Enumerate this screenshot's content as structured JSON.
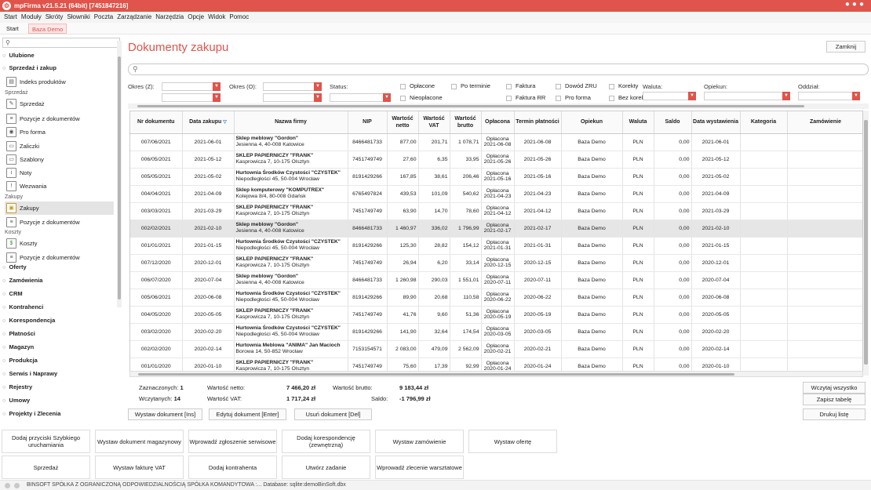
{
  "window": {
    "title": "mpFirma v21.5.21 (64bit) [7451847216]"
  },
  "menu": [
    "Start",
    "Moduły",
    "Skróty",
    "Słowniki",
    "Poczta",
    "Zarządzanie",
    "Narzędzia",
    "Opcje",
    "Widok",
    "Pomoc"
  ],
  "tabs": [
    {
      "label": "Start"
    },
    {
      "label": "Baza Demo"
    }
  ],
  "sidebar": {
    "search_placeholder": "",
    "sections_top": [
      {
        "label": "Ulubione"
      },
      {
        "label": "Sprzedaż i zakup"
      }
    ],
    "items_a": [
      {
        "label": "Indeks produktów",
        "icon": "box-icon"
      }
    ],
    "sub_sprzedaz": "Sprzedaż",
    "items_b": [
      {
        "label": "Sprzedaż"
      },
      {
        "label": "Pozycje z dokumentów"
      },
      {
        "label": "Pro forma"
      },
      {
        "label": "Zaliczki"
      },
      {
        "label": "Szablony"
      },
      {
        "label": "Noty"
      },
      {
        "label": "Wezwania"
      }
    ],
    "sub_zakupy": "Zakupy",
    "items_c": [
      {
        "label": "Zakupy"
      },
      {
        "label": "Pozycje z dokumentów"
      }
    ],
    "sub_koszty": "Koszty",
    "items_d": [
      {
        "label": "Koszty"
      },
      {
        "label": "Pozycje z dokumentów"
      }
    ],
    "sections_bottom": [
      {
        "label": "Oferty"
      },
      {
        "label": "Zamówienia"
      },
      {
        "label": "CRM"
      },
      {
        "label": "Kontrahenci"
      },
      {
        "label": "Korespondencja"
      },
      {
        "label": "Płatności"
      },
      {
        "label": "Magazyn"
      },
      {
        "label": "Produkcja"
      },
      {
        "label": "Serwis i Naprawy"
      },
      {
        "label": "Rejestry"
      },
      {
        "label": "Umowy"
      },
      {
        "label": "Projekty i Zlecenia"
      }
    ]
  },
  "main": {
    "title": "Dokumenty zakupu",
    "close_label": "Zamknij",
    "search_placeholder": "",
    "filters": {
      "okres_z": "Okres (Z):",
      "okres_o": "Okres (O):",
      "status": "Status:",
      "waluta": "Waluta:",
      "opiekun": "Opiekun:",
      "oddzial": "Oddział:"
    },
    "checks": [
      "Opłacone",
      "Po terminie",
      "Faktura",
      "Dowód ZRU",
      "Korekty",
      "Nieopłacone",
      "Faktura RR",
      "Pro forma",
      "Bez korekt"
    ],
    "columns": [
      "Nr dokumentu",
      "Data zakupu",
      "Nazwa firmy",
      "NIP",
      "Wartość netto",
      "Wartość VAT",
      "Wartość brutto",
      "Opłacona",
      "Termin płatności",
      "Opiekun",
      "Waluta",
      "Saldo",
      "Data wystawienia",
      "Kategoria",
      "Zamówienie"
    ],
    "rows": [
      {
        "nr": "007/06/2021",
        "data": "2021-06-01",
        "firma": "Sklep meblowy \"Gordon\"",
        "adres": "Jesienna 4, 40-008 Katowice",
        "nip": "8466481733",
        "netto": "877,00",
        "vat": "201,71",
        "brutto": "1 078,71",
        "op": "Opłacona",
        "opdata": "2021-06-08",
        "termin": "2021-06-08",
        "opiekun": "Baza Demo",
        "waluta": "PLN",
        "saldo": "0,00",
        "wyst": "2021-06-01",
        "kat": "",
        "zam": ""
      },
      {
        "nr": "006/05/2021",
        "data": "2021-05-12",
        "firma": "SKLEP PAPIERNICZY \"FRANK\"",
        "adres": "Kasprowicza 7, 10-175 Olsztyn",
        "nip": "7451749749",
        "netto": "27,60",
        "vat": "6,35",
        "brutto": "33,95",
        "op": "Opłacona",
        "opdata": "2021-05-26",
        "termin": "2021-05-26",
        "opiekun": "Baza Demo",
        "waluta": "PLN",
        "saldo": "0,00",
        "wyst": "2021-05-12",
        "kat": "",
        "zam": ""
      },
      {
        "nr": "005/05/2021",
        "data": "2021-05-02",
        "firma": "Hurtownia Środków Czystości \"CZYSTEK\"",
        "adres": "Niepodległości 45, 50-004 Wrocław",
        "nip": "8191429266",
        "netto": "167,85",
        "vat": "38,61",
        "brutto": "206,46",
        "op": "Opłacona",
        "opdata": "2021-05-16",
        "termin": "2021-05-16",
        "opiekun": "Baza Demo",
        "waluta": "PLN",
        "saldo": "0,00",
        "wyst": "2021-05-02",
        "kat": "",
        "zam": ""
      },
      {
        "nr": "004/04/2021",
        "data": "2021-04-09",
        "firma": "Sklep komputerowy \"KOMPUTREX\"",
        "adres": "Kolejowa 8/4, 80-008 Gdańsk",
        "nip": "6765497824",
        "netto": "439,53",
        "vat": "101,09",
        "brutto": "540,62",
        "op": "Opłacona",
        "opdata": "2021-04-23",
        "termin": "2021-04-23",
        "opiekun": "Baza Demo",
        "waluta": "PLN",
        "saldo": "0,00",
        "wyst": "2021-04-09",
        "kat": "",
        "zam": ""
      },
      {
        "nr": "003/03/2021",
        "data": "2021-03-29",
        "firma": "SKLEP PAPIERNICZY \"FRANK\"",
        "adres": "Kasprowicza 7, 10-175 Olsztyn",
        "nip": "7451749749",
        "netto": "63,90",
        "vat": "14,70",
        "brutto": "78,60",
        "op": "Opłacona",
        "opdata": "2021-04-12",
        "termin": "2021-04-12",
        "opiekun": "Baza Demo",
        "waluta": "PLN",
        "saldo": "0,00",
        "wyst": "2021-03-29",
        "kat": "",
        "zam": ""
      },
      {
        "nr": "002/02/2021",
        "data": "2021-02-10",
        "firma": "Sklep meblowy \"Gordon\"",
        "adres": "Jesienna 4, 40-008 Katowice",
        "nip": "8466481733",
        "netto": "1 460,97",
        "vat": "336,02",
        "brutto": "1 796,99",
        "op": "Opłacona",
        "opdata": "2021-02-17",
        "termin": "2021-02-17",
        "opiekun": "Baza Demo",
        "waluta": "PLN",
        "saldo": "0,00",
        "wyst": "2021-02-10",
        "kat": "",
        "zam": ""
      },
      {
        "nr": "001/01/2021",
        "data": "2021-01-15",
        "firma": "Hurtownia Środków Czystości \"CZYSTEK\"",
        "adres": "Niepodległości 45, 50-004 Wrocław",
        "nip": "8191429266",
        "netto": "125,30",
        "vat": "28,82",
        "brutto": "154,12",
        "op": "Opłacona",
        "opdata": "2021-01-31",
        "termin": "2021-01-31",
        "opiekun": "Baza Demo",
        "waluta": "PLN",
        "saldo": "0,00",
        "wyst": "2021-01-15",
        "kat": "",
        "zam": ""
      },
      {
        "nr": "007/12/2020",
        "data": "2020-12-01",
        "firma": "SKLEP PAPIERNICZY \"FRANK\"",
        "adres": "Kasprowicza 7, 10-175 Olsztyn",
        "nip": "7451749749",
        "netto": "26,94",
        "vat": "6,20",
        "brutto": "33,14",
        "op": "Opłacona",
        "opdata": "2020-12-15",
        "termin": "2020-12-15",
        "opiekun": "Baza Demo",
        "waluta": "PLN",
        "saldo": "0,00",
        "wyst": "2020-12-01",
        "kat": "",
        "zam": ""
      },
      {
        "nr": "006/07/2020",
        "data": "2020-07-04",
        "firma": "Sklep meblowy \"Gordon\"",
        "adres": "Jesienna 4, 40-008 Katowice",
        "nip": "8466481733",
        "netto": "1 260,98",
        "vat": "290,03",
        "brutto": "1 551,01",
        "op": "Opłacona",
        "opdata": "2020-07-11",
        "termin": "2020-07-11",
        "opiekun": "Baza Demo",
        "waluta": "PLN",
        "saldo": "0,00",
        "wyst": "2020-07-04",
        "kat": "",
        "zam": ""
      },
      {
        "nr": "005/06/2021",
        "data": "2020-06-08",
        "firma": "Hurtownia Środków Czystości \"CZYSTEK\"",
        "adres": "Niepodległości 45, 50-004 Wrocław",
        "nip": "8191429266",
        "netto": "89,90",
        "vat": "20,68",
        "brutto": "110,58",
        "op": "Opłacona",
        "opdata": "2020-06-22",
        "termin": "2020-06-22",
        "opiekun": "Baza Demo",
        "waluta": "PLN",
        "saldo": "0,00",
        "wyst": "2020-06-08",
        "kat": "",
        "zam": ""
      },
      {
        "nr": "004/05/2020",
        "data": "2020-05-05",
        "firma": "SKLEP PAPIERNICZY \"FRANK\"",
        "adres": "Kasprowicza 7, 10-175 Olsztyn",
        "nip": "7451749749",
        "netto": "41,76",
        "vat": "9,60",
        "brutto": "51,36",
        "op": "Opłacona",
        "opdata": "2020-05-19",
        "termin": "2020-05-19",
        "opiekun": "Baza Demo",
        "waluta": "PLN",
        "saldo": "0,00",
        "wyst": "2020-05-05",
        "kat": "",
        "zam": ""
      },
      {
        "nr": "003/02/2020",
        "data": "2020-02-20",
        "firma": "Hurtownia Środków Czystości \"CZYSTEK\"",
        "adres": "Niepodległości 45, 50-004 Wrocław",
        "nip": "8191429266",
        "netto": "141,90",
        "vat": "32,64",
        "brutto": "174,54",
        "op": "Opłacona",
        "opdata": "2020-03-05",
        "termin": "2020-03-05",
        "opiekun": "Baza Demo",
        "waluta": "PLN",
        "saldo": "0,00",
        "wyst": "2020-02-20",
        "kat": "",
        "zam": ""
      },
      {
        "nr": "002/02/2020",
        "data": "2020-02-14",
        "firma": "Hurtownia Meblowa \"ANIMA\" Jan Macioch",
        "adres": "Borowa 14, 50-852 Wrocław",
        "nip": "7153154571",
        "netto": "2 083,00",
        "vat": "479,09",
        "brutto": "2 562,09",
        "op": "Opłacona",
        "opdata": "2020-02-21",
        "termin": "2020-02-21",
        "opiekun": "Baza Demo",
        "waluta": "PLN",
        "saldo": "0,00",
        "wyst": "2020-02-14",
        "kat": "",
        "zam": ""
      },
      {
        "nr": "001/01/2020",
        "data": "2020-01-10",
        "firma": "SKLEP PAPIERNICZY \"FRANK\"",
        "adres": "Kasprowicza 7, 10-175 Olsztyn",
        "nip": "7451749749",
        "netto": "75,60",
        "vat": "17,39",
        "brutto": "92,99",
        "op": "Opłacona",
        "opdata": "2020-01-24",
        "termin": "2020-01-24",
        "opiekun": "Baza Demo",
        "waluta": "PLN",
        "saldo": "0,00",
        "wyst": "2020-01-10",
        "kat": "",
        "zam": ""
      }
    ],
    "summary": {
      "zazn_label": "Zaznaczonych:",
      "zazn_val": "1",
      "wczyt_label": "Wczytanych:",
      "wczyt_val": "14",
      "netto_label": "Wartość netto:",
      "netto_val": "7 466,20 zł",
      "vat_label": "Wartość VAT:",
      "vat_val": "1 717,24 zł",
      "brutto_label": "Wartość brutto:",
      "brutto_val": "9 183,44 zł",
      "saldo_label": "Saldo:",
      "saldo_val": "-1 796,99 zł"
    },
    "right_buttons": {
      "load_all": "Wczytaj wszystko",
      "save_table": "Zapisz tabelę",
      "print": "Drukuj listę"
    },
    "action_buttons": {
      "issue": "Wystaw dokument [Ins]",
      "edit": "Edytuj dokument [Enter]",
      "delete": "Usuń dokument [Del]"
    }
  },
  "quick_buttons": [
    [
      "Dodaj przyciski Szybkiego uruchamiania",
      "Wystaw dokument magazynowy",
      "Wprowadź zgłoszenie serwisowe",
      "Dodaj korespondencję (zewnętrzną)",
      "Wystaw zamówienie",
      "Wystaw ofertę"
    ],
    [
      "Sprzedaż",
      "Wystaw fakturę VAT",
      "Dodaj kontrahenta",
      "Utwórz zadanie",
      "Wprowadź zlecenie warsztatowe"
    ]
  ],
  "status": {
    "text": "BINSOFT SPÓŁKA Z OGRANICZONĄ ODPOWIEDZIALNOŚCIĄ SPÓŁKA KOMANDYTOWA :... Database: sqlite:demoBinSoft.dbx"
  }
}
